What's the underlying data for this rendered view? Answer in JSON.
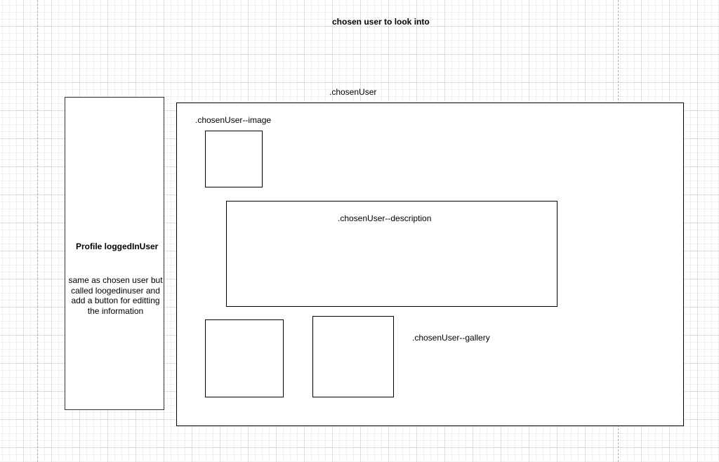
{
  "diagram": {
    "title": "chosen user to look into",
    "profile_panel": {
      "title": "Profile loggedInUser",
      "note": "same as chosen user but called loogedinuser and add a button for editting the information"
    },
    "chosen_user": {
      "label": ".chosenUser",
      "image_label": ".chosenUser--image",
      "description_label": ".chosenUser--description",
      "gallery_label": ".chosenUser--gallery"
    }
  }
}
